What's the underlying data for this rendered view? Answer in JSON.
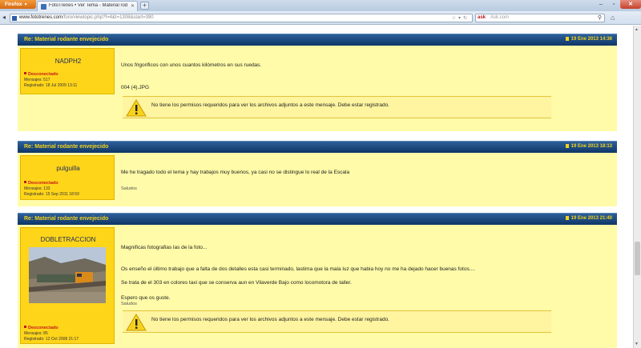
{
  "browser": {
    "menu_label": "Firefox",
    "tab_title": "FotoTrenes • Ver Tema - Material rodante ...",
    "url_host": "www.fototrenes.com",
    "url_path": "/foro/viewtopic.php?f=4&t=1308&start=390",
    "search_engine": "ask",
    "search_placeholder": "Ask.com"
  },
  "posts": [
    {
      "title": "Re: Material rodante envejecido",
      "date": "19 Ene 2013 14:36",
      "author": "NADPH2",
      "status": "Desconectado",
      "mensajes": "Mensajes: 517",
      "registrado": "Registrado: 18 Jul 2009 13:11",
      "lines": [
        "Unos frigorificos con unos cuantos kilómetros en sus ruedas.",
        "004 (4).JPG"
      ],
      "notice": "No tiene los permisos requeridos para ver los archivos adjuntos a este mensaje. Debe estar registrado."
    },
    {
      "title": "Re: Material rodante envejecido",
      "date": "19 Ene 2013 18:13",
      "author": "pulguilla",
      "status": "Desconectado",
      "mensajes": "Mensajes: 133",
      "registrado": "Registrado: 15 Sep 2011 18:50",
      "lines": [
        "Me he tragado todo el tema y hay trabajos muy buenos, ya casi no se distingue lo real de la Escala"
      ],
      "signature": "Saludos"
    },
    {
      "title": "Re: Material rodante envejecido",
      "date": "19 Ene 2013 21:40",
      "author": "DOBLETRACCION",
      "status": "Desconectado",
      "mensajes": "Mensajes: 85",
      "registrado": "Registrado: 12 Oct 2008 21:17",
      "lines": [
        "Magnificas fotografias las de la foto...",
        "Os enseño el último trabajo que a falta de dos detalles esta casi terminado, lastima que la mala luz que habia hoy no me ha dejado hacer buenas fotos....",
        "Se trata de el 303 en colores taxi que se conserva aun en Vilaverde Bajo como locomotora de taller.",
        "Espero que os guste."
      ],
      "signature": "Saludos",
      "notice": "No tiene los permisos requeridos para ver los archivos adjuntos a este mensaje. Debe estar registrado."
    }
  ]
}
